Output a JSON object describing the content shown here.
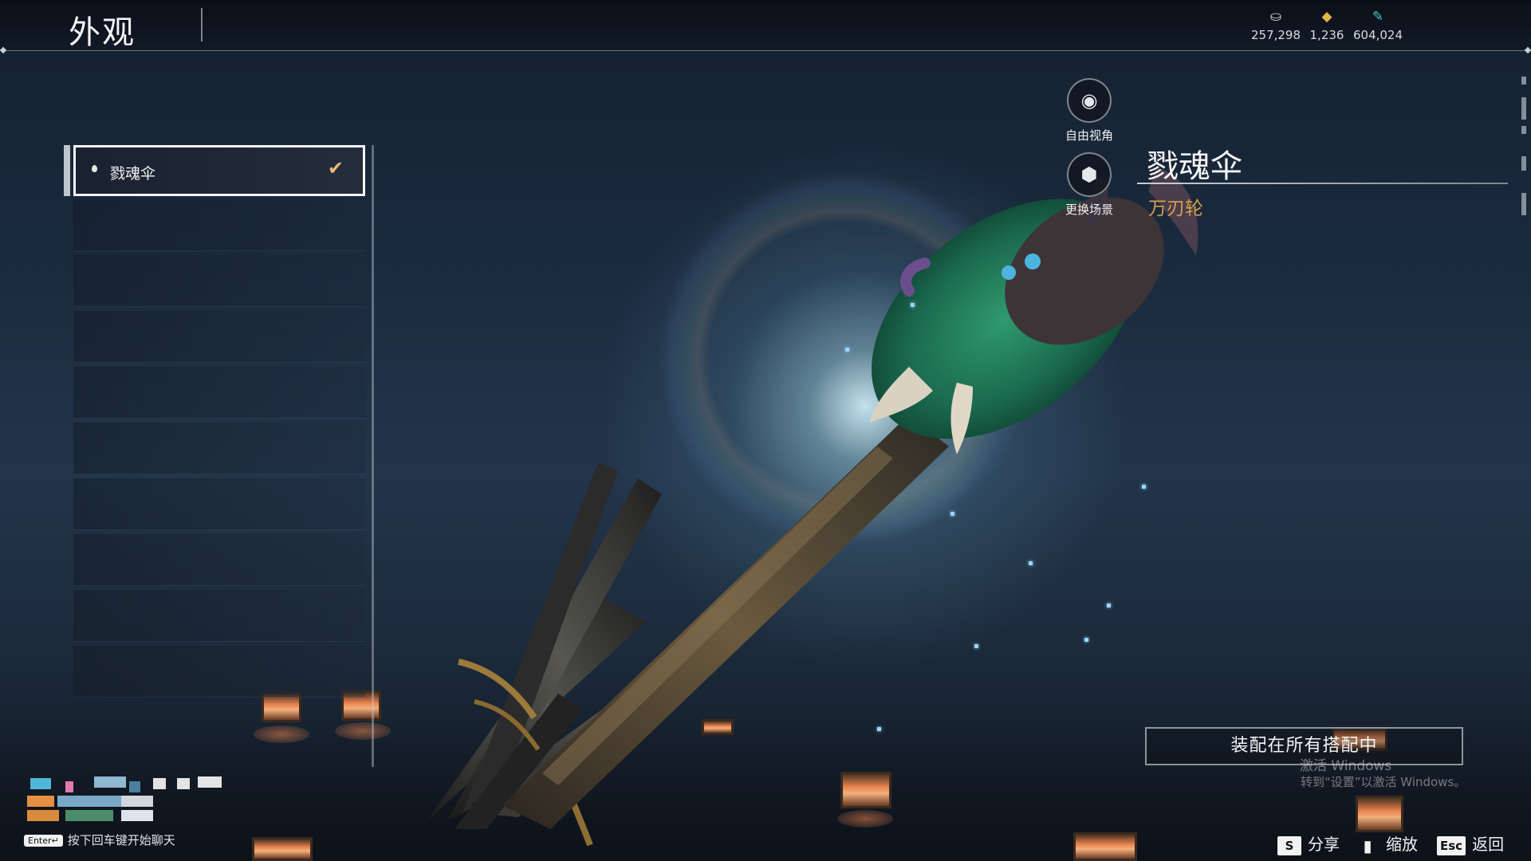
{
  "header": {
    "title": "外观",
    "currencies": [
      {
        "icon": "coin-icon",
        "value": "257,298",
        "color": "#d7dbe0"
      },
      {
        "icon": "gold-ingot-icon",
        "value": "1,236",
        "color": "#e4b44c"
      },
      {
        "icon": "feather-icon",
        "value": "604,024",
        "color": "#4fc3c8"
      }
    ]
  },
  "skin_list": {
    "items": [
      {
        "label": "戮魂伞",
        "selected": true
      }
    ]
  },
  "side_buttons": {
    "free_camera": "自由视角",
    "change_scene": "更换场景"
  },
  "detail": {
    "name": "戮魂伞",
    "type": "万刃轮",
    "type_color": "#d8a04a"
  },
  "equip_button": "装配在所有搭配中",
  "watermark": {
    "line1": "激活 Windows",
    "line2": "转到“设置”以激活 Windows。"
  },
  "chat": {
    "key": "Enter↵",
    "hint": "按下回车键开始聊天"
  },
  "footer": {
    "share": {
      "key": "S",
      "label": "分享"
    },
    "zoom": {
      "key": "",
      "label": "缩放"
    },
    "back": {
      "key": "Esc",
      "label": "返回"
    }
  }
}
